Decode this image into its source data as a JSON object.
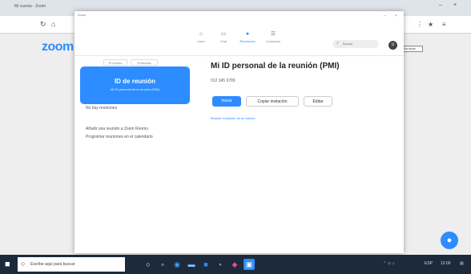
{
  "browser": {
    "tab_title": "Mi cuenta - Zoom",
    "page_tag": "Sin título",
    "logo": "zoom"
  },
  "zoom_window": {
    "title": "Zoom",
    "nav_tabs": [
      {
        "label": "Inicio",
        "icon": "home-icon"
      },
      {
        "label": "Chat",
        "icon": "chat-icon"
      },
      {
        "label": "Reuniones",
        "icon": "meetings-icon"
      },
      {
        "label": "Contactos",
        "icon": "contacts-icon"
      }
    ],
    "search_placeholder": "Buscar",
    "avatar_initial": "U"
  },
  "meetings": {
    "segment_labels": [
      "Próximas",
      "Grabadas"
    ],
    "card_big": "ID de reunión",
    "card_small": "Mi ID personal de la reunión (PMI)",
    "left_line_1": "No hay reuniones",
    "left_line_2": "Añadir una reunión a Zoom Rooms",
    "left_line_3": "Programar reuniones en el calendario",
    "pmi_title": "Mi ID personal de la reunión (PMI)",
    "pmi_id": "012 345 6789",
    "btn_start": "Iniciar",
    "btn_copy": "Copiar invitación",
    "btn_edit": "Editar",
    "link_invite": "Mostrar invitación de la reunión"
  },
  "taskbar": {
    "search_text": "Escribe aquí para buscar",
    "time": "12:00",
    "lang": "ESP"
  },
  "colors": {
    "accent": "#2d8cff",
    "taskbar": "#1c2a3c"
  }
}
